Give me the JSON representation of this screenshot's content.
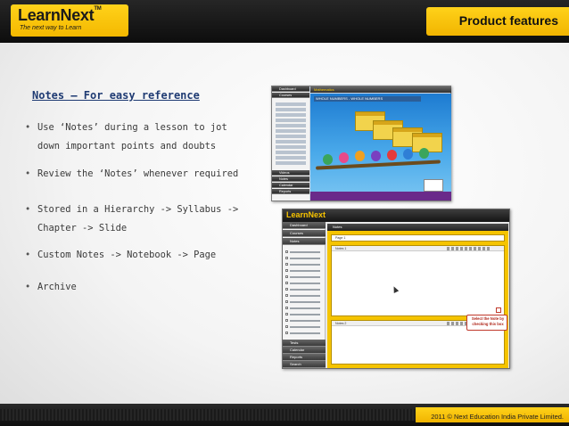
{
  "header": {
    "brand": "LearnNext",
    "brand_tm": "TM",
    "tagline": "The next way to Learn",
    "title": "Product features"
  },
  "section": {
    "title": "Notes – For easy reference"
  },
  "bullets": [
    "Use ‘Notes’ during a lesson to jot down important points and doubts",
    "Review the ‘Notes’ whenever required",
    "Stored in a Hierarchy ->  Syllabus -> Chapter -> Slide",
    "Custom Notes -> Notebook -> Page",
    "Archive"
  ],
  "screenshot1": {
    "sidebar_tabs": [
      "Dashboard",
      "Courses"
    ],
    "bottom_tabs": [
      "Videos",
      "Notes",
      "Calendar",
      "Reports"
    ],
    "top_title": "Mathematics",
    "lesson_title": "WHOLE NUMBERS - WHOLE NUMBERS"
  },
  "screenshot2": {
    "brand": "LearnNext",
    "nav": [
      "Dashboard",
      "Courses",
      "Notes"
    ],
    "nav_bottom": [
      "Tests",
      "Calendar",
      "Reports",
      "Search"
    ],
    "main_title": "Notes",
    "page_label": "Page 1",
    "note_labels": [
      "Notes 1",
      "Notes 2"
    ],
    "callout": "Select the Note by checking this box"
  },
  "footer": {
    "copyright": "2011 © Next Education India Private Limited."
  }
}
